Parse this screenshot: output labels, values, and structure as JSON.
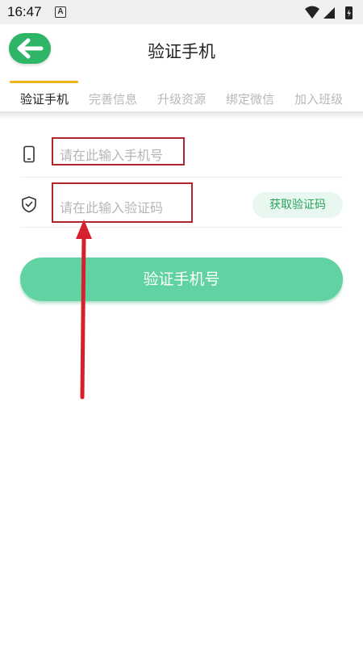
{
  "status_bar": {
    "time": "16:47",
    "notification_letter": "A"
  },
  "header": {
    "title": "验证手机",
    "back_icon": "arrow-left-icon"
  },
  "tabs": [
    {
      "label": "验证手机",
      "active": true
    },
    {
      "label": "完善信息",
      "active": false
    },
    {
      "label": "升级资源",
      "active": false
    },
    {
      "label": "绑定微信",
      "active": false
    },
    {
      "label": "加入班级",
      "active": false
    }
  ],
  "form": {
    "phone": {
      "placeholder": "请在此输入手机号",
      "value": "",
      "icon": "phone-icon"
    },
    "code": {
      "placeholder": "请在此输入验证码",
      "value": "",
      "icon": "shield-check-icon"
    },
    "get_code_label": "获取验证码",
    "submit_label": "验证手机号"
  },
  "colors": {
    "accent_green": "#2fb566",
    "submit_green": "#61d3a2",
    "tab_indicator": "#f2b21a",
    "annotation_red": "#d6202e"
  }
}
